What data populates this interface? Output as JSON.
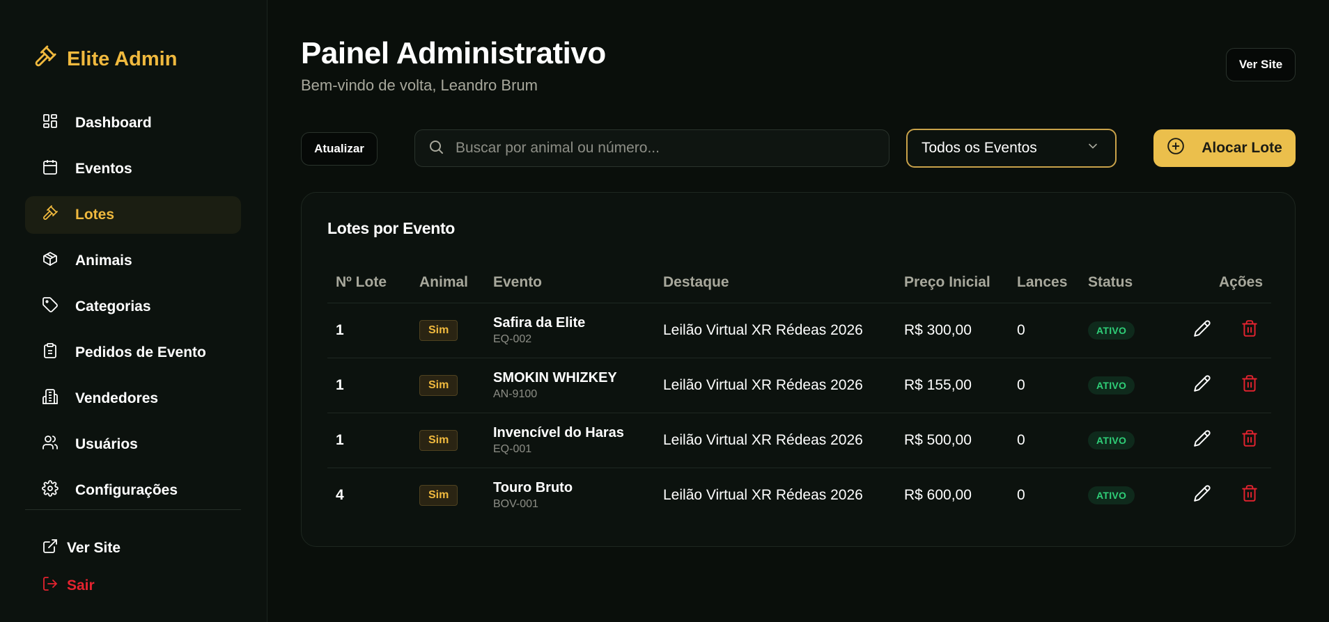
{
  "sidebar": {
    "brand": "Elite Admin",
    "items": [
      {
        "label": "Dashboard",
        "icon": "dashboard-icon"
      },
      {
        "label": "Eventos",
        "icon": "calendar-icon"
      },
      {
        "label": "Lotes",
        "icon": "gavel-icon",
        "active": true
      },
      {
        "label": "Animais",
        "icon": "box-icon"
      },
      {
        "label": "Categorias",
        "icon": "tag-icon"
      },
      {
        "label": "Pedidos de Evento",
        "icon": "clipboard-icon"
      },
      {
        "label": "Vendedores",
        "icon": "building-icon"
      },
      {
        "label": "Usuários",
        "icon": "users-icon"
      },
      {
        "label": "Configurações",
        "icon": "gear-icon"
      }
    ],
    "ver_site": "Ver Site",
    "sair": "Sair"
  },
  "header": {
    "title": "Painel Administrativo",
    "subtitle": "Bem-vindo de volta, Leandro Brum",
    "ver_site_button": "Ver Site"
  },
  "toolbar": {
    "refresh_button": "Atualizar",
    "search_placeholder": "Buscar por animal ou número...",
    "event_filter": "Todos os Eventos",
    "allocate_button": "Alocar Lote"
  },
  "table": {
    "title": "Lotes por Evento",
    "columns": [
      "Nº Lote",
      "Animal",
      "Evento",
      "Destaque",
      "Preço Inicial",
      "Lances",
      "Status",
      "Ações"
    ],
    "rows": [
      {
        "lote": "1",
        "animal": "Sim",
        "evento_nome": "Safira da Elite",
        "evento_codigo": "EQ-002",
        "destaque": "Leilão Virtual XR Rédeas 2026",
        "preco": "R$ 300,00",
        "lances": "0",
        "status": "ATIVO"
      },
      {
        "lote": "1",
        "animal": "Sim",
        "evento_nome": "SMOKIN WHIZKEY",
        "evento_codigo": "AN-9100",
        "destaque": "Leilão Virtual XR Rédeas 2026",
        "preco": "R$ 155,00",
        "lances": "0",
        "status": "ATIVO"
      },
      {
        "lote": "1",
        "animal": "Sim",
        "evento_nome": "Invencível do Haras",
        "evento_codigo": "EQ-001",
        "destaque": "Leilão Virtual XR Rédeas 2026",
        "preco": "R$ 500,00",
        "lances": "0",
        "status": "ATIVO"
      },
      {
        "lote": "4",
        "animal": "Sim",
        "evento_nome": "Touro Bruto",
        "evento_codigo": "BOV-001",
        "destaque": "Leilão Virtual XR Rédeas 2026",
        "preco": "R$ 600,00",
        "lances": "0",
        "status": "ATIVO"
      }
    ]
  },
  "colors": {
    "accent": "#f0b93e",
    "primary_button": "#ebbf4c",
    "danger": "#e5232f",
    "status_active": "#2fcf78",
    "background": "#0a0f0b"
  }
}
